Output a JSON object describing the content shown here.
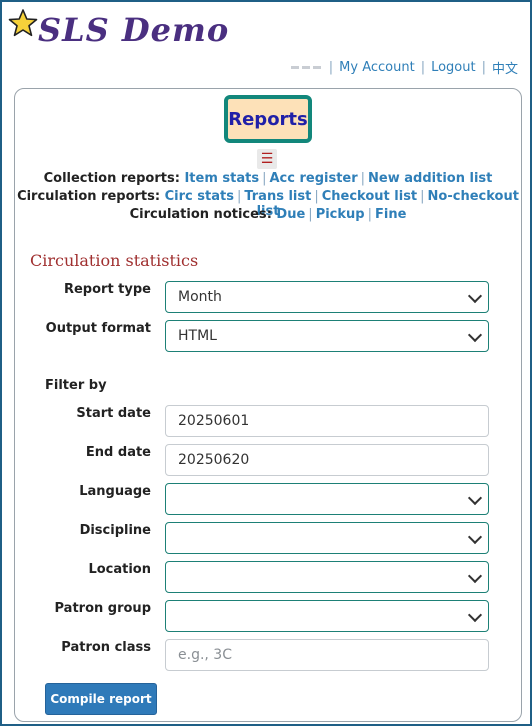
{
  "header": {
    "logo_text": "SLS Demo",
    "nav": {
      "my_account": "My Account",
      "logout": "Logout",
      "language": "中文"
    }
  },
  "tab": {
    "label": "Reports"
  },
  "menu_icon": "☰",
  "collection": {
    "label": "Collection reports",
    "links": [
      "Item stats",
      "Acc register",
      "New addition list"
    ]
  },
  "circulation": {
    "label": "Circulation reports",
    "links": [
      "Circ stats",
      "Trans list",
      "Checkout list",
      "No-checkout list"
    ]
  },
  "notices": {
    "label": "Circulation notices",
    "links": [
      "Due",
      "Pickup",
      "Fine"
    ]
  },
  "form": {
    "title": "Circulation statistics",
    "report_type": {
      "label": "Report type",
      "value": "Month"
    },
    "output_format": {
      "label": "Output format",
      "value": "HTML"
    },
    "filter_by": "Filter by",
    "start_date": {
      "label": "Start date",
      "value": "20250601"
    },
    "end_date": {
      "label": "End date",
      "value": "20250620"
    },
    "language": {
      "label": "Language",
      "value": ""
    },
    "discipline": {
      "label": "Discipline",
      "value": ""
    },
    "location": {
      "label": "Location",
      "value": ""
    },
    "patron_group": {
      "label": "Patron group",
      "value": ""
    },
    "patron_class": {
      "label": "Patron class",
      "placeholder": "e.g., 3C"
    },
    "compile_label": "Compile report"
  },
  "colors": {
    "brand": "#4a2f80",
    "accent": "#2f7fb8",
    "tab_bg": "#fde1b8",
    "tab_border": "#12877b",
    "section_title": "#a03030",
    "button": "#2f7ab9"
  }
}
